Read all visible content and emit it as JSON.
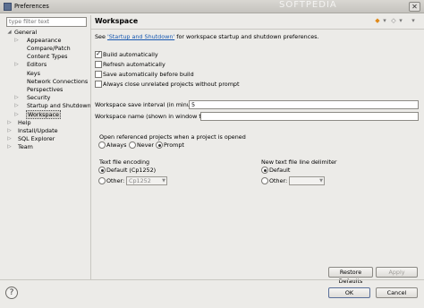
{
  "window": {
    "title": "Preferences",
    "close_glyph": "✕"
  },
  "watermark": "SOFTPEDIA",
  "filter": {
    "placeholder": "type filter text"
  },
  "tree": {
    "general": "General",
    "children": [
      "Appearance",
      "Compare/Patch",
      "Content Types",
      "Editors",
      "Keys",
      "Network Connections",
      "Perspectives",
      "Security",
      "Startup and Shutdown",
      "Workspace"
    ],
    "help": "Help",
    "install_update": "Install/Update",
    "sql_explorer": "SQL Explorer",
    "team": "Team"
  },
  "header": {
    "title": "Workspace",
    "nav": {
      "back": "◆",
      "dropdown": "▾",
      "forward": "◇"
    }
  },
  "intro": {
    "prefix": "See ",
    "link": "'Startup and Shutdown'",
    "suffix": " for workspace startup and shutdown preferences."
  },
  "options": [
    {
      "label": "Build automatically",
      "checked": true
    },
    {
      "label": "Refresh automatically",
      "checked": false
    },
    {
      "label": "Save automatically before build",
      "checked": false
    },
    {
      "label": "Always close unrelated projects without prompt",
      "checked": false
    }
  ],
  "save_interval": {
    "label": "Workspace save interval (in minutes):",
    "value": "5"
  },
  "workspace_name": {
    "label": "Workspace name (shown in window title):",
    "value": ""
  },
  "open_referenced": {
    "label": "Open referenced projects when a project is opened",
    "options": [
      "Always",
      "Never",
      "Prompt"
    ],
    "selected": "Prompt"
  },
  "encoding": {
    "label": "Text file encoding",
    "default_label": "Default (Cp1252)",
    "other_label": "Other:",
    "other_value": "Cp1252",
    "selected": "Default"
  },
  "line_delimiter": {
    "label": "New text file line delimiter",
    "default_label": "Default",
    "other_label": "Other:",
    "other_value": "",
    "selected": "Default"
  },
  "buttons": {
    "restore_defaults": "Restore Defaults",
    "apply": "Apply",
    "ok": "OK",
    "cancel": "Cancel",
    "help": "?"
  }
}
